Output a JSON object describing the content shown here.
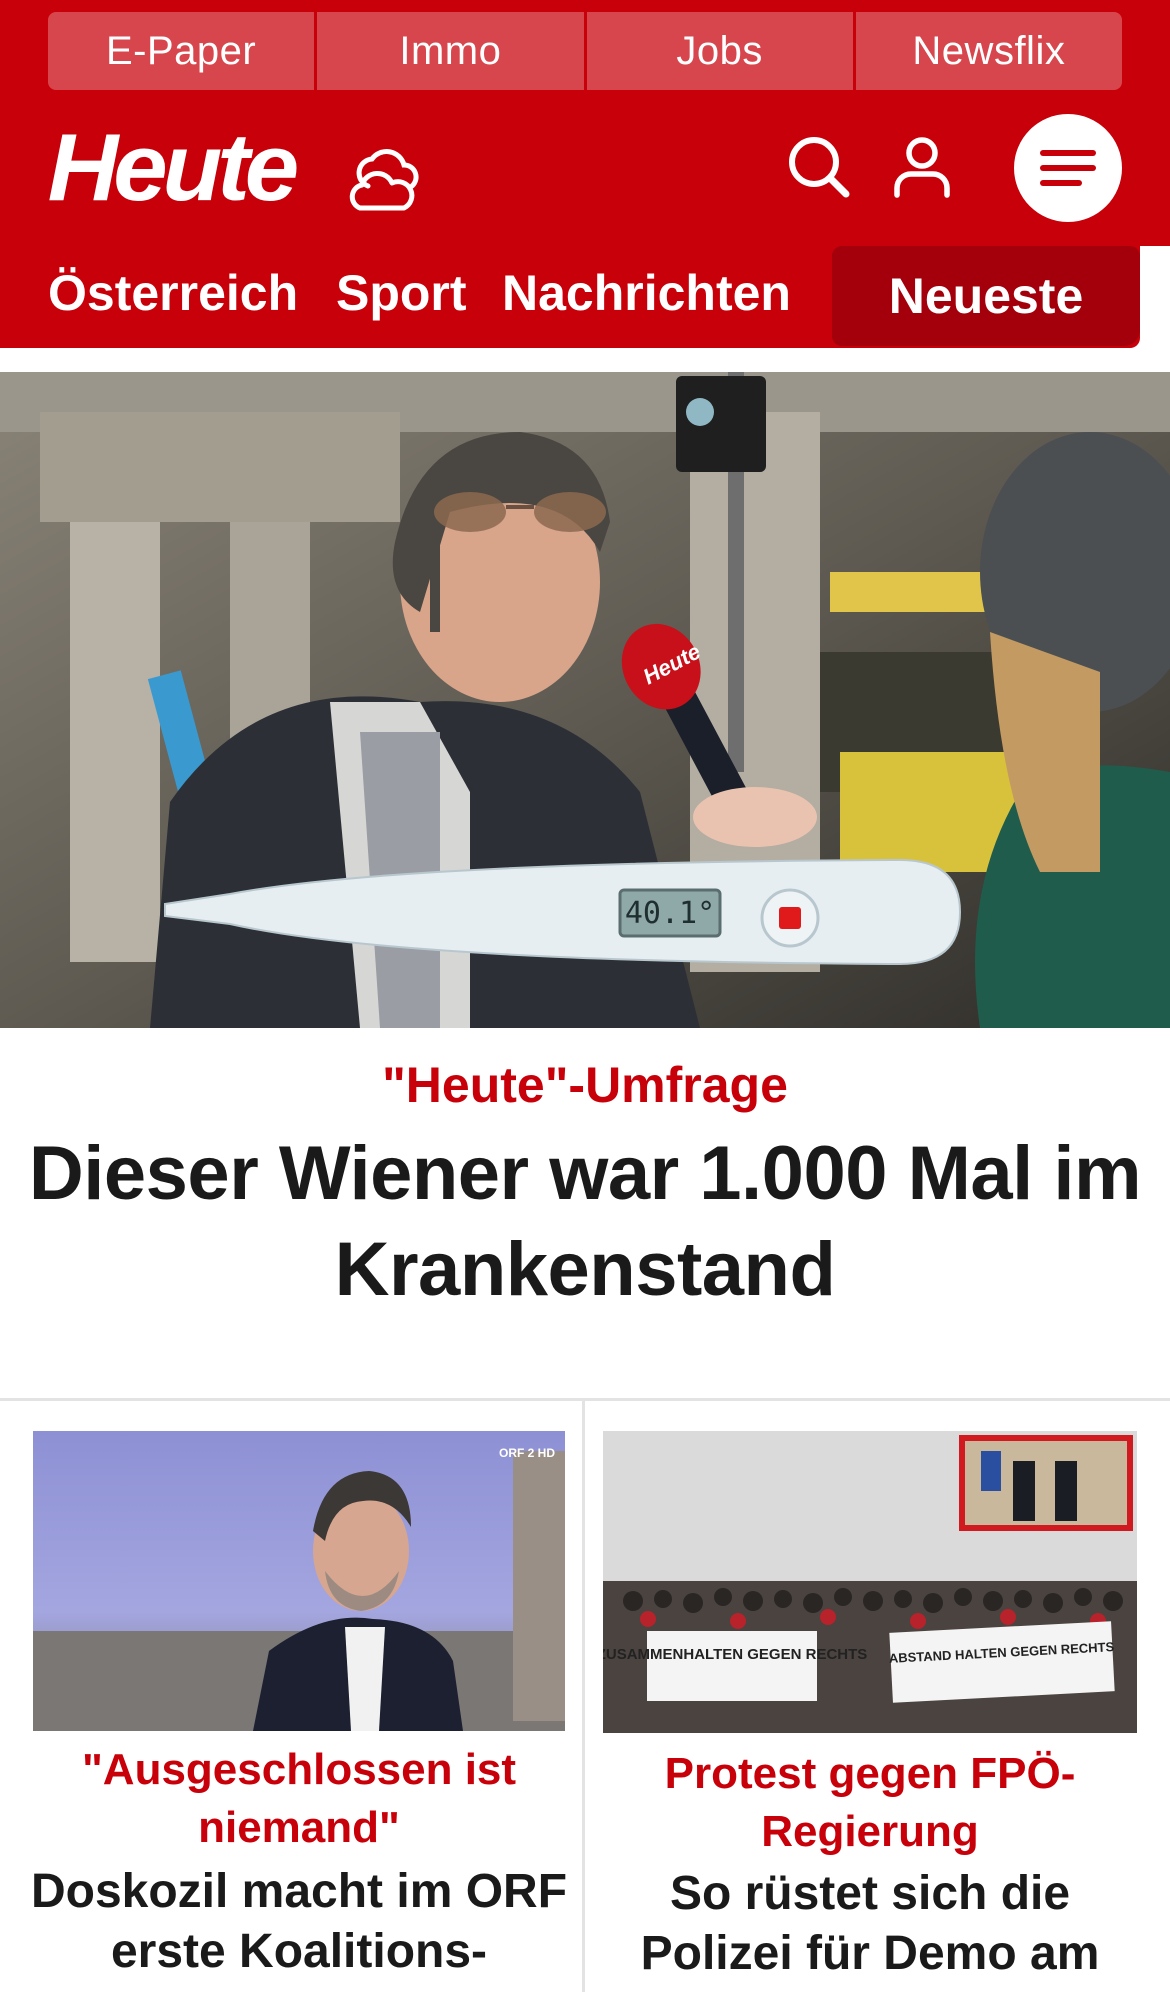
{
  "header": {
    "top_links": [
      "E-Paper",
      "Immo",
      "Jobs",
      "Newsflix"
    ],
    "logo": "Heute",
    "brand_color": "#c8000a"
  },
  "nav": {
    "items": [
      "Österreich",
      "Sport",
      "Nachrichten"
    ],
    "active": "Neueste"
  },
  "hero": {
    "kicker": "\"Heute\"-Umfrage",
    "title": "Dieser Wiener war 1.000 Mal im Krankenstand",
    "image_alt": "Man interviewed with microphone, thermometer graphic",
    "thermometer_reading": "40.1°",
    "mic_label": "Heute"
  },
  "cards": [
    {
      "kicker": "\"Ausgeschlossen ist niemand\"",
      "title": "Doskozil macht im ORF erste Koalitions-",
      "image_alt": "Man in suit in TV studio",
      "image_overlay": "ORF 2 HD"
    },
    {
      "kicker": "Protest gegen FPÖ-Regierung",
      "title": "So rüstet sich die Polizei für Demo am",
      "image_alt": "Protest crowd with banners",
      "banner_left": "ZUSAMMENHALTEN GEGEN RECHTS",
      "banner_right": "ABSTAND HALTEN GEGEN RECHTS"
    }
  ],
  "icons": [
    "cloud-weather-icon",
    "search-icon",
    "user-icon",
    "menu-icon"
  ]
}
